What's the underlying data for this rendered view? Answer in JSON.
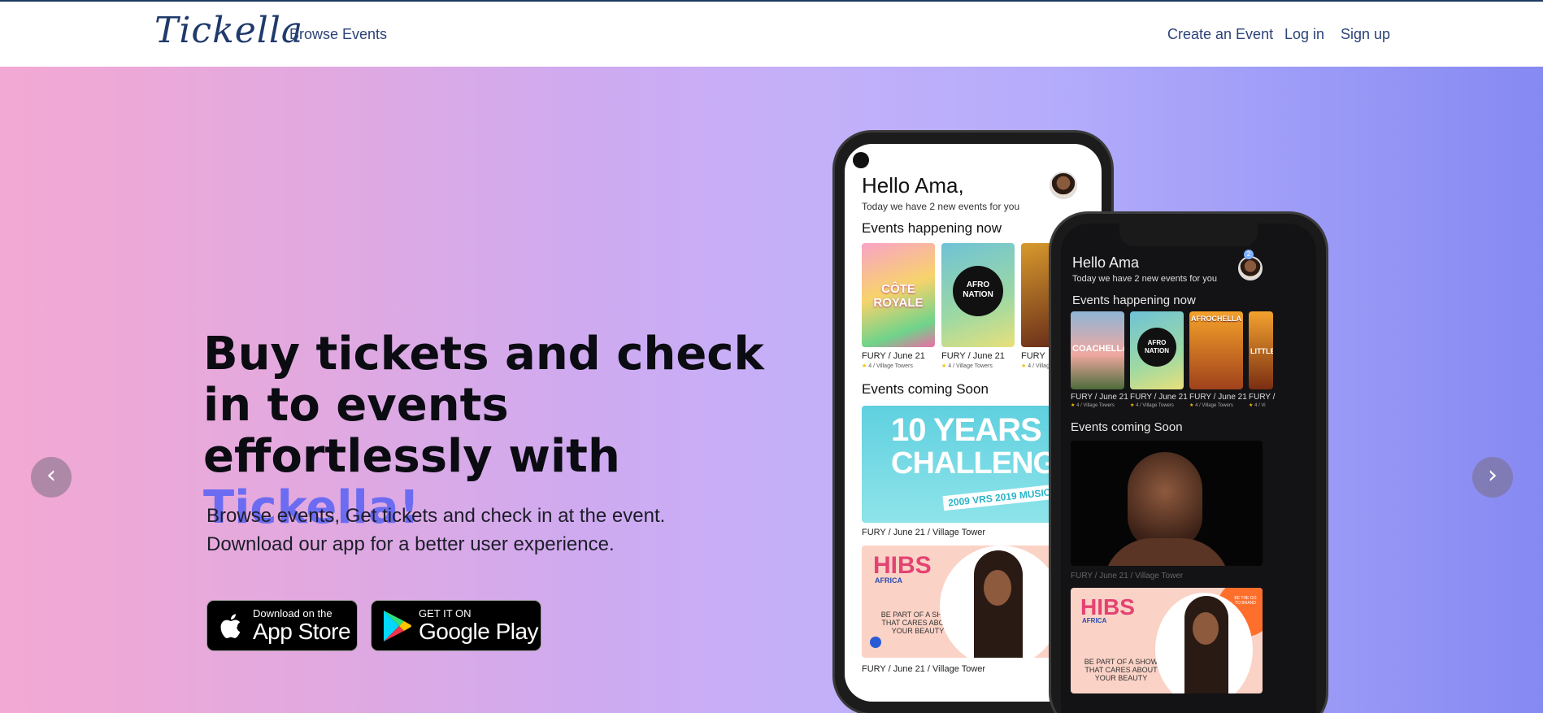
{
  "nav": {
    "logo": "Tickella",
    "browse_events": "Browse Events",
    "create_event": "Create an Event",
    "log_in": "Log in",
    "sign_up": "Sign up"
  },
  "hero": {
    "headline_part1": "Buy tickets and check in to events effortlessly with ",
    "headline_brand": "Tickella!",
    "sub_line1": "Browse events, Get tickets and check in at the event.",
    "sub_line2": "Download our app for a better user experience.",
    "app_store": {
      "small": "Download on the",
      "big": "App Store"
    },
    "google_play": {
      "small": "GET IT ON",
      "big": "Google Play"
    },
    "prev_arrow": "‹",
    "next_arrow": "›"
  },
  "phone_light": {
    "greeting": "Hello Ama,",
    "subtitle": "Today we have 2 new events for you",
    "section_now": "Events happening now",
    "cards": [
      {
        "poster": "CÔTE ROYALE",
        "caption": "FURY / June 21",
        "meta": "4 / Village Towers"
      },
      {
        "poster": "AFRO NATION",
        "caption": "FURY / June 21",
        "meta": "4 / Village Towers"
      },
      {
        "poster": "",
        "caption": "FURY",
        "meta": "4 / Village"
      }
    ],
    "section_soon": "Events coming Soon",
    "banner1": {
      "line1": "10 YEARS",
      "line2": "CHALLENGE",
      "line3": "2009 VRS 2019 MUSIC"
    },
    "banner1_caption": "FURY / June 21 / Village Tower",
    "banner2": {
      "title": "HIBS",
      "subtitle": "AFRICA",
      "tagline": "BE PART OF A SHOW THAT CARES ABOUT YOUR BEAUTY"
    },
    "banner2_caption": "FURY / June 21 / Village Tower"
  },
  "phone_dark": {
    "greeting": "Hello Ama",
    "subtitle": "Today we have 2 new events for you",
    "badge": "2",
    "section_now": "Events happening now",
    "cards": [
      {
        "poster": "COACHELLA",
        "caption": "FURY / June 21",
        "meta": "4 / Village Towers"
      },
      {
        "poster": "AFRO NATION",
        "caption": "FURY / June 21",
        "meta": "4 / Village Towers"
      },
      {
        "poster": "AFROCHELLA",
        "caption": "FURY / June 21",
        "meta": "4 / Village Towers"
      },
      {
        "poster": "LITTLE",
        "caption": "FURY /",
        "meta": "4 / Vi"
      }
    ],
    "section_soon": "Events coming Soon",
    "banner1_caption": "FURY / June 21 / Village Tower",
    "banner2": {
      "title": "HIBS",
      "subtitle": "AFRICA",
      "tagline": "BE PART OF A SHOW THAT CARES ABOUT YOUR BEAUTY",
      "corner": "BE THE GO TO BRAND"
    }
  },
  "colors": {
    "brand": "#6c6cf2",
    "nav_text": "#2c4378"
  }
}
